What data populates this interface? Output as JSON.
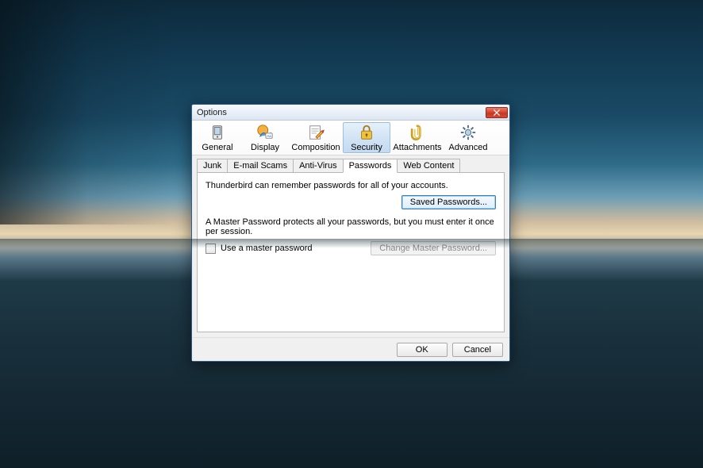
{
  "window": {
    "title": "Options"
  },
  "categories": [
    {
      "id": "general",
      "label": "General",
      "selected": false
    },
    {
      "id": "display",
      "label": "Display",
      "selected": false
    },
    {
      "id": "composition",
      "label": "Composition",
      "selected": false
    },
    {
      "id": "security",
      "label": "Security",
      "selected": true
    },
    {
      "id": "attachments",
      "label": "Attachments",
      "selected": false
    },
    {
      "id": "advanced",
      "label": "Advanced",
      "selected": false
    }
  ],
  "subtabs": [
    {
      "id": "junk",
      "label": "Junk",
      "active": false
    },
    {
      "id": "emailscams",
      "label": "E-mail Scams",
      "active": false
    },
    {
      "id": "antivirus",
      "label": "Anti-Virus",
      "active": false
    },
    {
      "id": "passwords",
      "label": "Passwords",
      "active": true
    },
    {
      "id": "webcontent",
      "label": "Web Content",
      "active": false
    }
  ],
  "panel": {
    "intro": "Thunderbird can remember passwords for all of your accounts.",
    "saved_passwords_btn": "Saved Passwords...",
    "master_desc": "A Master Password protects all your passwords, but you must enter it once per session.",
    "use_master_label": "Use a master password",
    "use_master_checked": false,
    "change_master_btn": "Change Master Password...",
    "change_master_enabled": false
  },
  "footer": {
    "ok": "OK",
    "cancel": "Cancel"
  }
}
